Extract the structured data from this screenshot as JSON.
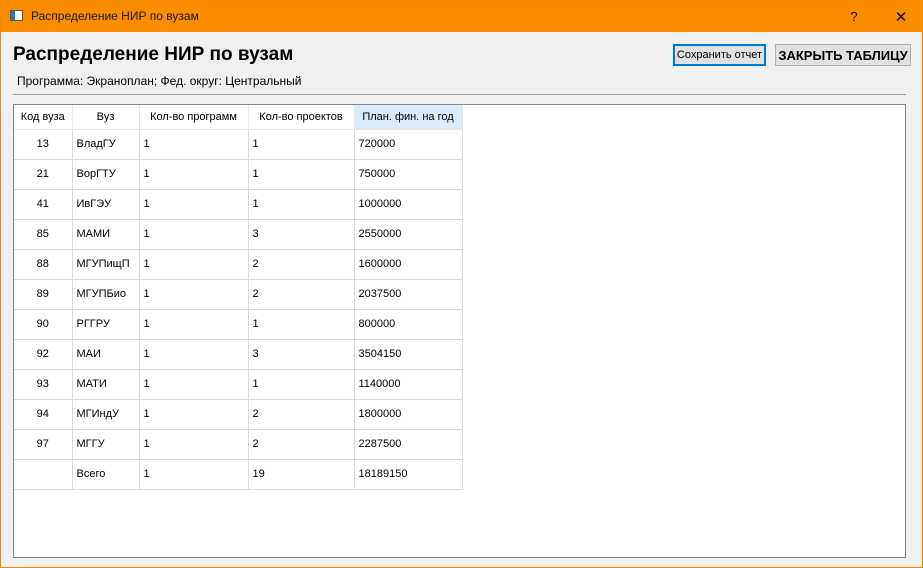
{
  "window": {
    "title": "Распределение НИР по вузам",
    "help_label": "?",
    "close_label": "✕"
  },
  "header": {
    "title": "Распределение НИР по вузам",
    "subtitle": "Программа: Экраноплан; Фед. округ: Центральный"
  },
  "buttons": {
    "save_label": "Сохранить отчет",
    "close_table_label": "ЗАКРЫТЬ ТАБЛИЦУ"
  },
  "table": {
    "columns": [
      "Код вуза",
      "Вуз",
      "Кол-во программ",
      "Кол-во проектов",
      "План. фин. на год"
    ],
    "sorted_column": 4,
    "rows": [
      [
        "13",
        "ВладГУ",
        "1",
        "1",
        "720000"
      ],
      [
        "21",
        "ВорГТУ",
        "1",
        "1",
        "750000"
      ],
      [
        "41",
        "ИвГЭУ",
        "1",
        "1",
        "1000000"
      ],
      [
        "85",
        "МАМИ",
        "1",
        "3",
        "2550000"
      ],
      [
        "88",
        "МГУПищП",
        "1",
        "2",
        "1600000"
      ],
      [
        "89",
        "МГУПБио",
        "1",
        "2",
        "2037500"
      ],
      [
        "90",
        "РГГРУ",
        "1",
        "1",
        "800000"
      ],
      [
        "92",
        "МАИ",
        "1",
        "3",
        "3504150"
      ],
      [
        "93",
        "МАТИ",
        "1",
        "1",
        "1140000"
      ],
      [
        "94",
        "МГИндУ",
        "1",
        "2",
        "1800000"
      ],
      [
        "97",
        "МГГУ",
        "1",
        "2",
        "2287500"
      ],
      [
        "",
        "Всего",
        "1",
        "19",
        "18189150"
      ]
    ]
  },
  "colors": {
    "titlebar": "#fa8c00",
    "sorted_header": "#d9ebf9",
    "focus_border": "#0078d7"
  }
}
